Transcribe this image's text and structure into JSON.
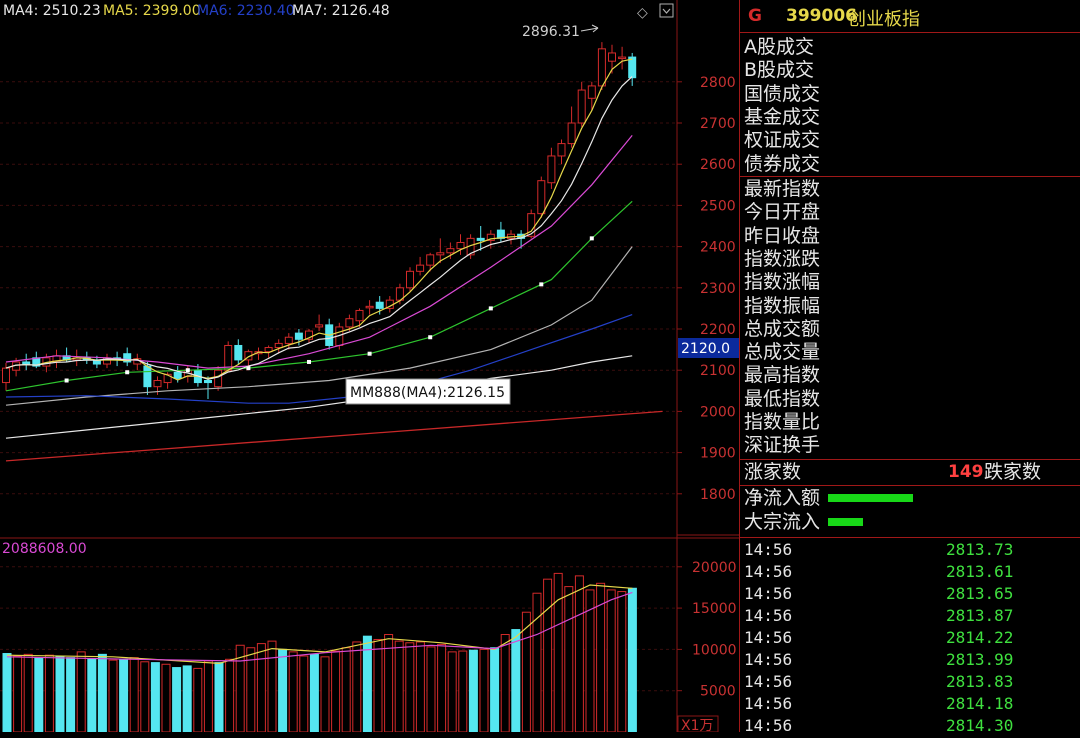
{
  "colors": {
    "up": "#d42a2a",
    "down": "#55e6f0",
    "grid": "#3a0d0d",
    "axis_frame": "#8a1616",
    "axis_text": "#c83232",
    "ma4": "#e8e8e8",
    "ma5": "#e6d84a",
    "ma6": "#2440c8",
    "ma7": "#e8e8e8",
    "ma10": "#d94ad4",
    "ma20": "#2ec42e",
    "ma60": "#b4b4b4",
    "trend": "#c82828",
    "green_val": "#3fe03f"
  },
  "legend": {
    "ma4": "MA4: 2510.23",
    "ma5": "MA5: 2399.00",
    "ma6": "MA6: 2230.40",
    "ma7": "MA7: 2126.48"
  },
  "annotations": {
    "high_label": "2896.31",
    "tooltip": "MM888(MA4):2126.15",
    "cursor_price": "2120.0",
    "volume_value": "2088608.00",
    "volume_unit": "X1万"
  },
  "chart_data": [
    {
      "type": "candlestick",
      "title": "",
      "xlabel": "",
      "ylabel": "",
      "ylim": [
        1700,
        2950
      ],
      "yticks": [
        1800,
        1900,
        2000,
        2100,
        2200,
        2300,
        2400,
        2500,
        2600,
        2700,
        2800
      ],
      "grid": true,
      "candles": [
        {
          "o": 2070,
          "h": 2118,
          "l": 2050,
          "c": 2105
        },
        {
          "o": 2100,
          "h": 2130,
          "l": 2085,
          "c": 2120
        },
        {
          "o": 2120,
          "h": 2140,
          "l": 2100,
          "c": 2115
        },
        {
          "o": 2130,
          "h": 2145,
          "l": 2105,
          "c": 2110
        },
        {
          "o": 2110,
          "h": 2140,
          "l": 2095,
          "c": 2130
        },
        {
          "o": 2120,
          "h": 2150,
          "l": 2105,
          "c": 2135
        },
        {
          "o": 2135,
          "h": 2155,
          "l": 2120,
          "c": 2125
        },
        {
          "o": 2125,
          "h": 2150,
          "l": 2110,
          "c": 2130
        },
        {
          "o": 2130,
          "h": 2145,
          "l": 2115,
          "c": 2125
        },
        {
          "o": 2125,
          "h": 2135,
          "l": 2105,
          "c": 2115
        },
        {
          "o": 2115,
          "h": 2140,
          "l": 2105,
          "c": 2130
        },
        {
          "o": 2130,
          "h": 2145,
          "l": 2110,
          "c": 2128
        },
        {
          "o": 2140,
          "h": 2155,
          "l": 2110,
          "c": 2120
        },
        {
          "o": 2115,
          "h": 2140,
          "l": 2100,
          "c": 2128
        },
        {
          "o": 2110,
          "h": 2120,
          "l": 2040,
          "c": 2060
        },
        {
          "o": 2060,
          "h": 2085,
          "l": 2040,
          "c": 2075
        },
        {
          "o": 2070,
          "h": 2095,
          "l": 2055,
          "c": 2090
        },
        {
          "o": 2095,
          "h": 2110,
          "l": 2070,
          "c": 2080
        },
        {
          "o": 2085,
          "h": 2110,
          "l": 2070,
          "c": 2100
        },
        {
          "o": 2100,
          "h": 2115,
          "l": 2060,
          "c": 2070
        },
        {
          "o": 2075,
          "h": 2085,
          "l": 2030,
          "c": 2070
        },
        {
          "o": 2060,
          "h": 2110,
          "l": 2050,
          "c": 2100
        },
        {
          "o": 2100,
          "h": 2170,
          "l": 2095,
          "c": 2160
        },
        {
          "o": 2160,
          "h": 2175,
          "l": 2115,
          "c": 2125
        },
        {
          "o": 2125,
          "h": 2150,
          "l": 2110,
          "c": 2145
        },
        {
          "o": 2140,
          "h": 2155,
          "l": 2125,
          "c": 2145
        },
        {
          "o": 2145,
          "h": 2160,
          "l": 2130,
          "c": 2155
        },
        {
          "o": 2155,
          "h": 2175,
          "l": 2140,
          "c": 2165
        },
        {
          "o": 2165,
          "h": 2190,
          "l": 2150,
          "c": 2180
        },
        {
          "o": 2190,
          "h": 2200,
          "l": 2160,
          "c": 2175
        },
        {
          "o": 2175,
          "h": 2200,
          "l": 2165,
          "c": 2195
        },
        {
          "o": 2205,
          "h": 2235,
          "l": 2195,
          "c": 2210
        },
        {
          "o": 2210,
          "h": 2225,
          "l": 2150,
          "c": 2160
        },
        {
          "o": 2160,
          "h": 2215,
          "l": 2150,
          "c": 2205
        },
        {
          "o": 2205,
          "h": 2235,
          "l": 2195,
          "c": 2225
        },
        {
          "o": 2220,
          "h": 2250,
          "l": 2205,
          "c": 2245
        },
        {
          "o": 2255,
          "h": 2270,
          "l": 2235,
          "c": 2255
        },
        {
          "o": 2265,
          "h": 2280,
          "l": 2235,
          "c": 2250
        },
        {
          "o": 2250,
          "h": 2280,
          "l": 2240,
          "c": 2270
        },
        {
          "o": 2270,
          "h": 2310,
          "l": 2260,
          "c": 2300
        },
        {
          "o": 2300,
          "h": 2350,
          "l": 2290,
          "c": 2340
        },
        {
          "o": 2340,
          "h": 2375,
          "l": 2330,
          "c": 2355
        },
        {
          "o": 2355,
          "h": 2385,
          "l": 2340,
          "c": 2380
        },
        {
          "o": 2380,
          "h": 2420,
          "l": 2360,
          "c": 2385
        },
        {
          "o": 2385,
          "h": 2410,
          "l": 2370,
          "c": 2395
        },
        {
          "o": 2395,
          "h": 2430,
          "l": 2380,
          "c": 2410
        },
        {
          "o": 2380,
          "h": 2430,
          "l": 2370,
          "c": 2420
        },
        {
          "o": 2420,
          "h": 2450,
          "l": 2390,
          "c": 2415
        },
        {
          "o": 2415,
          "h": 2440,
          "l": 2395,
          "c": 2430
        },
        {
          "o": 2440,
          "h": 2460,
          "l": 2410,
          "c": 2420
        },
        {
          "o": 2420,
          "h": 2440,
          "l": 2405,
          "c": 2430
        },
        {
          "o": 2430,
          "h": 2440,
          "l": 2395,
          "c": 2420
        },
        {
          "o": 2425,
          "h": 2490,
          "l": 2420,
          "c": 2480
        },
        {
          "o": 2480,
          "h": 2570,
          "l": 2470,
          "c": 2560
        },
        {
          "o": 2555,
          "h": 2640,
          "l": 2540,
          "c": 2620
        },
        {
          "o": 2620,
          "h": 2660,
          "l": 2600,
          "c": 2650
        },
        {
          "o": 2650,
          "h": 2740,
          "l": 2640,
          "c": 2700
        },
        {
          "o": 2700,
          "h": 2800,
          "l": 2690,
          "c": 2780
        },
        {
          "o": 2760,
          "h": 2800,
          "l": 2730,
          "c": 2790
        },
        {
          "o": 2790,
          "h": 2896.31,
          "l": 2780,
          "c": 2880
        },
        {
          "o": 2850,
          "h": 2890,
          "l": 2820,
          "c": 2870
        },
        {
          "o": 2860,
          "h": 2885,
          "l": 2830,
          "c": 2860
        },
        {
          "o": 2860,
          "h": 2870,
          "l": 2790,
          "c": 2810
        }
      ],
      "ma_lines": [
        {
          "key": "ma10",
          "points": [
            [
              0,
              2120
            ],
            [
              5,
              2135
            ],
            [
              10,
              2130
            ],
            [
              15,
              2120
            ],
            [
              20,
              2105
            ],
            [
              24,
              2110
            ],
            [
              30,
              2140
            ],
            [
              36,
              2180
            ],
            [
              42,
              2255
            ],
            [
              48,
              2350
            ],
            [
              54,
              2450
            ],
            [
              58,
              2550
            ],
            [
              62,
              2670
            ]
          ]
        },
        {
          "key": "ma20",
          "points": [
            [
              0,
              2050
            ],
            [
              6,
              2075
            ],
            [
              12,
              2095
            ],
            [
              18,
              2100
            ],
            [
              24,
              2105
            ],
            [
              30,
              2120
            ],
            [
              36,
              2140
            ],
            [
              42,
              2180
            ],
            [
              48,
              2250
            ],
            [
              54,
              2320
            ],
            [
              58,
              2420
            ],
            [
              62,
              2510
            ]
          ]
        },
        {
          "key": "ma60",
          "points": [
            [
              0,
              2015
            ],
            [
              8,
              2035
            ],
            [
              16,
              2050
            ],
            [
              24,
              2060
            ],
            [
              32,
              2075
            ],
            [
              40,
              2105
            ],
            [
              48,
              2150
            ],
            [
              54,
              2210
            ],
            [
              58,
              2270
            ],
            [
              62,
              2400
            ]
          ]
        },
        {
          "key": "ma6",
          "points": [
            [
              0,
              2035
            ],
            [
              8,
              2038
            ],
            [
              16,
              2030
            ],
            [
              24,
              2020
            ],
            [
              28,
              2020
            ],
            [
              34,
              2035
            ],
            [
              40,
              2060
            ],
            [
              46,
              2100
            ],
            [
              52,
              2150
            ],
            [
              58,
              2200
            ],
            [
              62,
              2235
            ]
          ]
        },
        {
          "key": "ma7",
          "points": [
            [
              0,
              1935
            ],
            [
              10,
              1960
            ],
            [
              20,
              1985
            ],
            [
              30,
              2010
            ],
            [
              40,
              2045
            ],
            [
              48,
              2080
            ],
            [
              54,
              2100
            ],
            [
              58,
              2120
            ],
            [
              62,
              2135
            ]
          ]
        }
      ],
      "fast_ma_from_close": [
        {
          "key": "ma5",
          "window": 4
        },
        {
          "key": "ma4",
          "window": 7
        }
      ],
      "trend_line": {
        "from": [
          0,
          1880
        ],
        "to": [
          65,
          2000
        ]
      }
    },
    {
      "type": "bar",
      "title": "",
      "xlabel": "",
      "ylabel": "",
      "ylim": [
        0,
        23000
      ],
      "yticks": [
        5000,
        10000,
        15000,
        20000
      ],
      "volume": [
        9500,
        9200,
        9400,
        9000,
        9300,
        9100,
        9000,
        9700,
        8900,
        9400,
        8700,
        8800,
        9000,
        8500,
        8400,
        8200,
        7800,
        8000,
        7700,
        8600,
        8400,
        8800,
        10500,
        10200,
        10700,
        11000,
        10000,
        9700,
        9200,
        9400,
        9100,
        9800,
        10200,
        10900,
        11600,
        11200,
        11800,
        11000,
        10800,
        10900,
        10300,
        10600,
        9700,
        9800,
        9900,
        10000,
        10200,
        11800,
        12400,
        14500,
        16800,
        18500,
        19200,
        17600,
        18900,
        17200,
        18000,
        17200,
        17000,
        17400
      ],
      "ma_lines": [
        {
          "key": "ma5",
          "points": [
            [
              0,
              9300
            ],
            [
              10,
              9100
            ],
            [
              20,
              8300
            ],
            [
              25,
              10100
            ],
            [
              30,
              9700
            ],
            [
              36,
              11300
            ],
            [
              41,
              10800
            ],
            [
              46,
              10000
            ],
            [
              48,
              11500
            ],
            [
              52,
              16000
            ],
            [
              55,
              17800
            ],
            [
              59,
              17400
            ]
          ]
        },
        {
          "key": "ma10",
          "points": [
            [
              0,
              9100
            ],
            [
              12,
              8800
            ],
            [
              22,
              8600
            ],
            [
              30,
              9600
            ],
            [
              40,
              10500
            ],
            [
              46,
              10100
            ],
            [
              50,
              11800
            ],
            [
              54,
              14200
            ],
            [
              57,
              16000
            ],
            [
              59,
              16900
            ]
          ]
        }
      ]
    }
  ],
  "panel": {
    "code_prefix": "G",
    "code": "399006",
    "name": "创业板指",
    "trade_labels": [
      "A股成交",
      "B股成交",
      "国债成交",
      "基金成交",
      "权证成交",
      "债券成交"
    ],
    "index_labels": [
      "最新指数",
      "今日开盘",
      "昨日收盘",
      "指数涨跌",
      "指数涨幅",
      "指数振幅",
      "总成交额",
      "总成交量",
      "最高指数",
      "最低指数",
      "指数量比",
      "深证换手"
    ],
    "advance_label": "涨家数",
    "advance_count": "149",
    "decline_label": "跌家数",
    "net_inflow_label": "净流入额",
    "bulk_inflow_label": "大宗流入",
    "net_inflow_ratio": 0.85,
    "bulk_inflow_ratio": 0.35,
    "ticks": [
      {
        "time": "14:56",
        "price": "2813.73"
      },
      {
        "time": "14:56",
        "price": "2813.61"
      },
      {
        "time": "14:56",
        "price": "2813.65"
      },
      {
        "time": "14:56",
        "price": "2813.87"
      },
      {
        "time": "14:56",
        "price": "2814.22"
      },
      {
        "time": "14:56",
        "price": "2813.99"
      },
      {
        "time": "14:56",
        "price": "2813.83"
      },
      {
        "time": "14:56",
        "price": "2814.18"
      },
      {
        "time": "14:56",
        "price": "2814.30"
      }
    ]
  }
}
